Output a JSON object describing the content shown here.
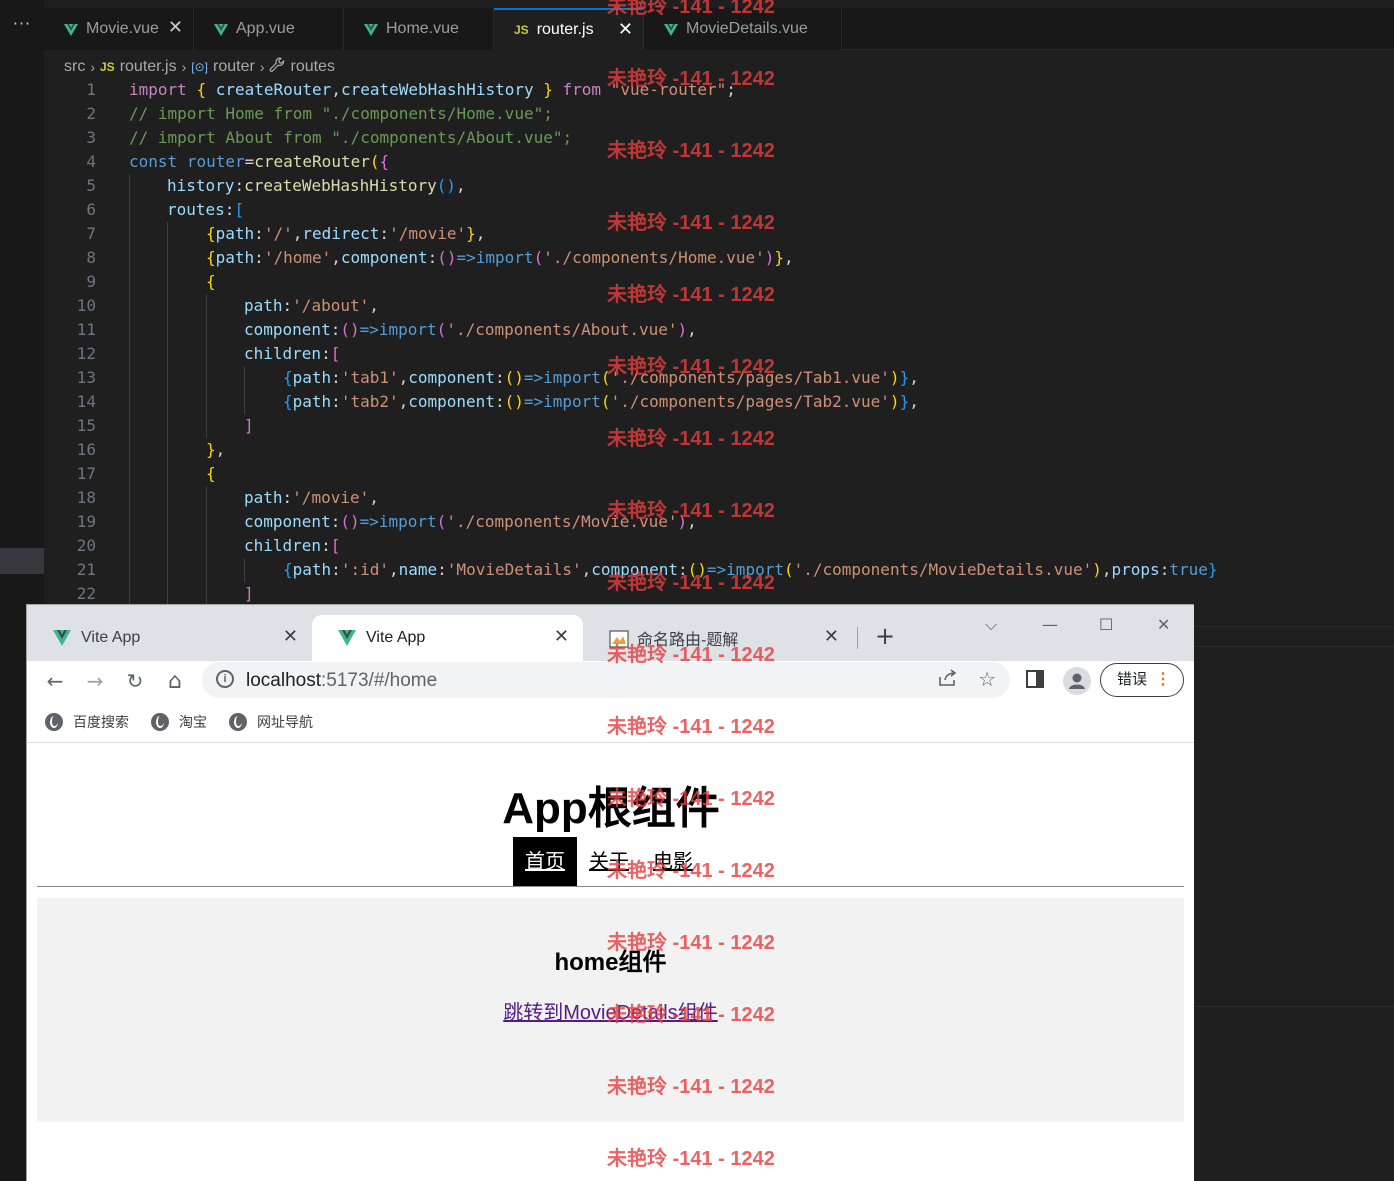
{
  "vscode": {
    "more_label": "···",
    "tabs": [
      {
        "label": "Movie.vue",
        "icon": "vue-icon",
        "close": "✕"
      },
      {
        "label": "App.vue",
        "icon": "vue-icon"
      },
      {
        "label": "Home.vue",
        "icon": "vue-icon"
      },
      {
        "label": "router.js",
        "icon": "js-icon",
        "icon_text": "JS",
        "close": "✕"
      },
      {
        "label": "MovieDetails.vue",
        "icon": "vue-icon"
      }
    ],
    "breadcrumb": {
      "folder": "src",
      "file": "router.js",
      "file_icon": "JS",
      "symbol": "router",
      "symbol_icon": "[⊙]",
      "property": "routes",
      "property_icon": "wrench-icon",
      "separator": "›"
    },
    "line_numbers": [
      "1",
      "2",
      "3",
      "4",
      "5",
      "6",
      "7",
      "8",
      "9",
      "10",
      "11",
      "12",
      "13",
      "14",
      "15",
      "16",
      "17",
      "18",
      "19",
      "20",
      "21",
      "22"
    ]
  },
  "chrome": {
    "tabs": [
      {
        "title": "Vite App",
        "close": "✕"
      },
      {
        "title": "Vite App",
        "close": "✕"
      },
      {
        "title": "命名路由-题解",
        "close": "✕"
      }
    ],
    "new_tab": "+",
    "window_controls": {
      "dropdown": "⌵",
      "minimize": "—",
      "maximize": "☐",
      "close": "✕"
    },
    "toolbar": {
      "back": "←",
      "forward": "→",
      "reload": "↻",
      "home": "⌂",
      "url_host": "localhost",
      "url_rest": ":5173/#/home",
      "info_icon_text": "i",
      "error_label": "错误",
      "error_dots": "⋮"
    },
    "bookmarks": [
      {
        "label": "百度搜索"
      },
      {
        "label": "淘宝"
      },
      {
        "label": "网址导航"
      }
    ]
  },
  "webpage": {
    "title": "App根组件",
    "nav": [
      {
        "label": "首页",
        "active": true
      },
      {
        "label": "关于",
        "active": false
      },
      {
        "label": "电影",
        "active": false
      }
    ],
    "home_title": "home组件",
    "home_link": "跳转到MovieDetails组件"
  },
  "watermark": {
    "text": "未艳玲 -141 - 1242",
    "color": "#e63c3c"
  },
  "colors": {
    "editor_bg": "#1f1f1f",
    "tab_accent": "#0078d4",
    "vue_green": "#41b883",
    "js_yellow": "#cbcb41",
    "link_visited": "#551a8b"
  }
}
